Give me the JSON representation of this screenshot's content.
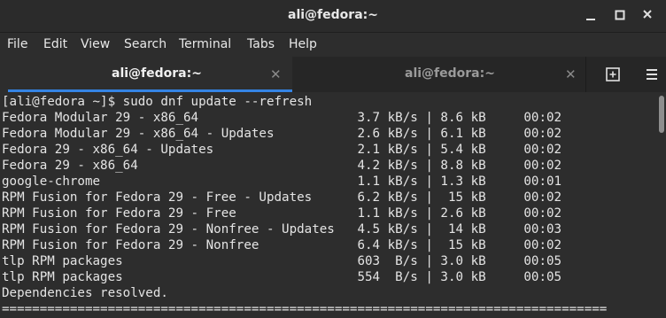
{
  "window": {
    "title": "ali@fedora:~"
  },
  "menu": [
    "File",
    "Edit",
    "View",
    "Search",
    "Terminal",
    "Tabs",
    "Help"
  ],
  "tabs": [
    {
      "label": "ali@fedora:~",
      "active": true
    },
    {
      "label": "ali@fedora:~",
      "active": false
    }
  ],
  "icons": {
    "minimize": "minimize-icon",
    "maximize": "maximize-icon",
    "close": "close-icon",
    "tab_close": "close-icon",
    "new_tab": "new-tab-icon",
    "tab_menu": "menu-icon"
  },
  "colors": {
    "accent": "#3584e4",
    "background": "#2d2d2d",
    "text": "#e4e4e4"
  },
  "terminal": {
    "lines": [
      "[ali@fedora ~]$ sudo dnf update --refresh",
      "Fedora Modular 29 - x86_64                     3.7 kB/s | 8.6 kB     00:02",
      "Fedora Modular 29 - x86_64 - Updates           2.6 kB/s | 6.1 kB     00:02",
      "Fedora 29 - x86_64 - Updates                   2.1 kB/s | 5.4 kB     00:02",
      "Fedora 29 - x86_64                             4.2 kB/s | 8.8 kB     00:02",
      "google-chrome                                  1.1 kB/s | 1.3 kB     00:01",
      "RPM Fusion for Fedora 29 - Free - Updates      6.2 kB/s |  15 kB     00:02",
      "RPM Fusion for Fedora 29 - Free                1.1 kB/s | 2.6 kB     00:02",
      "RPM Fusion for Fedora 29 - Nonfree - Updates   4.5 kB/s |  14 kB     00:03",
      "RPM Fusion for Fedora 29 - Nonfree             6.4 kB/s |  15 kB     00:02",
      "tlp RPM packages                               603  B/s | 3.0 kB     00:05",
      "tlp RPM packages                               554  B/s | 3.0 kB     00:05",
      "Dependencies resolved.",
      "================================================================================"
    ]
  }
}
